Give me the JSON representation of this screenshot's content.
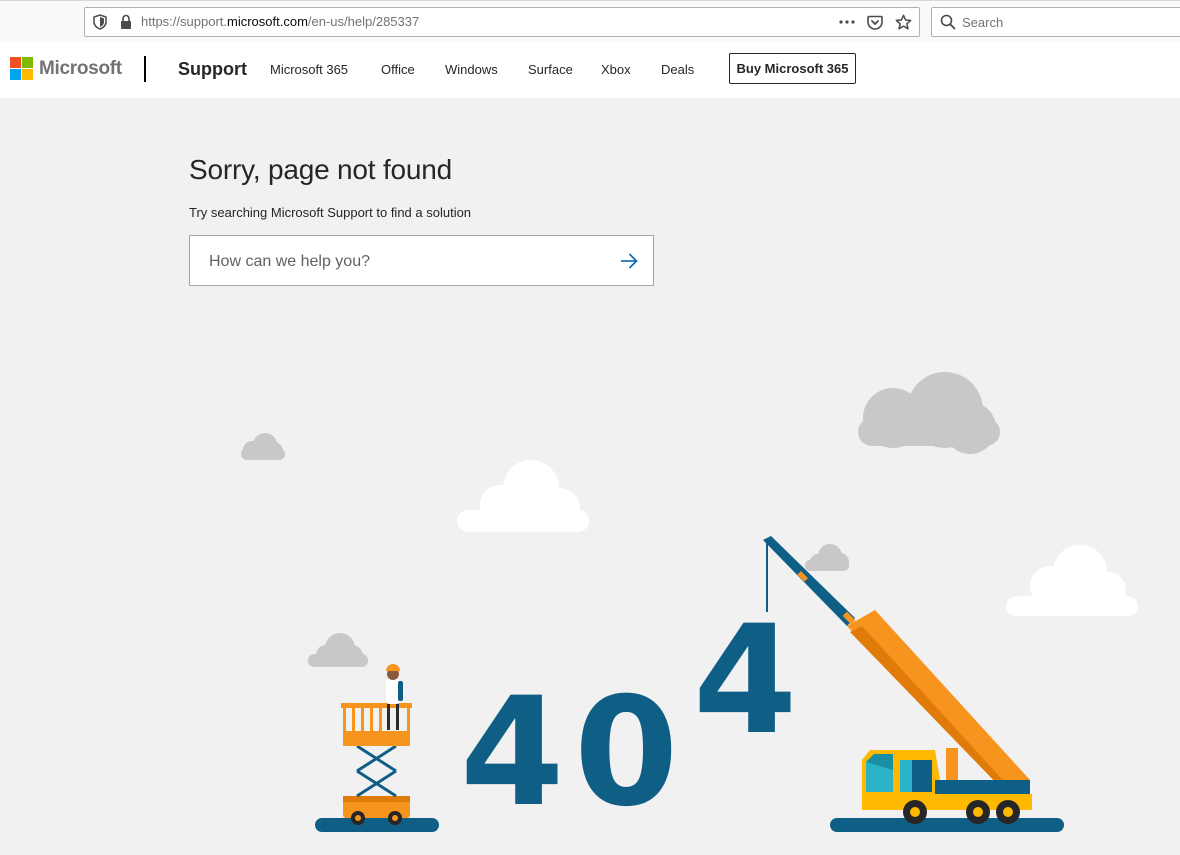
{
  "browser": {
    "url_prefix": "https://support.",
    "url_host": "microsoft.com",
    "url_path": "/en-us/help/285337",
    "search_placeholder": "Search"
  },
  "header": {
    "brand": "Microsoft",
    "section": "Support",
    "nav": [
      "Microsoft 365",
      "Office",
      "Windows",
      "Surface",
      "Xbox",
      "Deals"
    ],
    "cta": "Buy Microsoft 365"
  },
  "main": {
    "title": "Sorry, page not found",
    "subtitle": "Try searching Microsoft Support to find a solution",
    "search_placeholder": "How can we help you?"
  },
  "illustration": {
    "digits": [
      "4",
      "0",
      "4"
    ]
  },
  "colors": {
    "brand_red": "#f25022",
    "brand_green": "#7fba00",
    "brand_blue": "#00a4ef",
    "brand_yellow": "#ffb900",
    "digit_blue": "#0e5e86",
    "accent_orange": "#f7941d",
    "link_blue": "#0067b8"
  }
}
